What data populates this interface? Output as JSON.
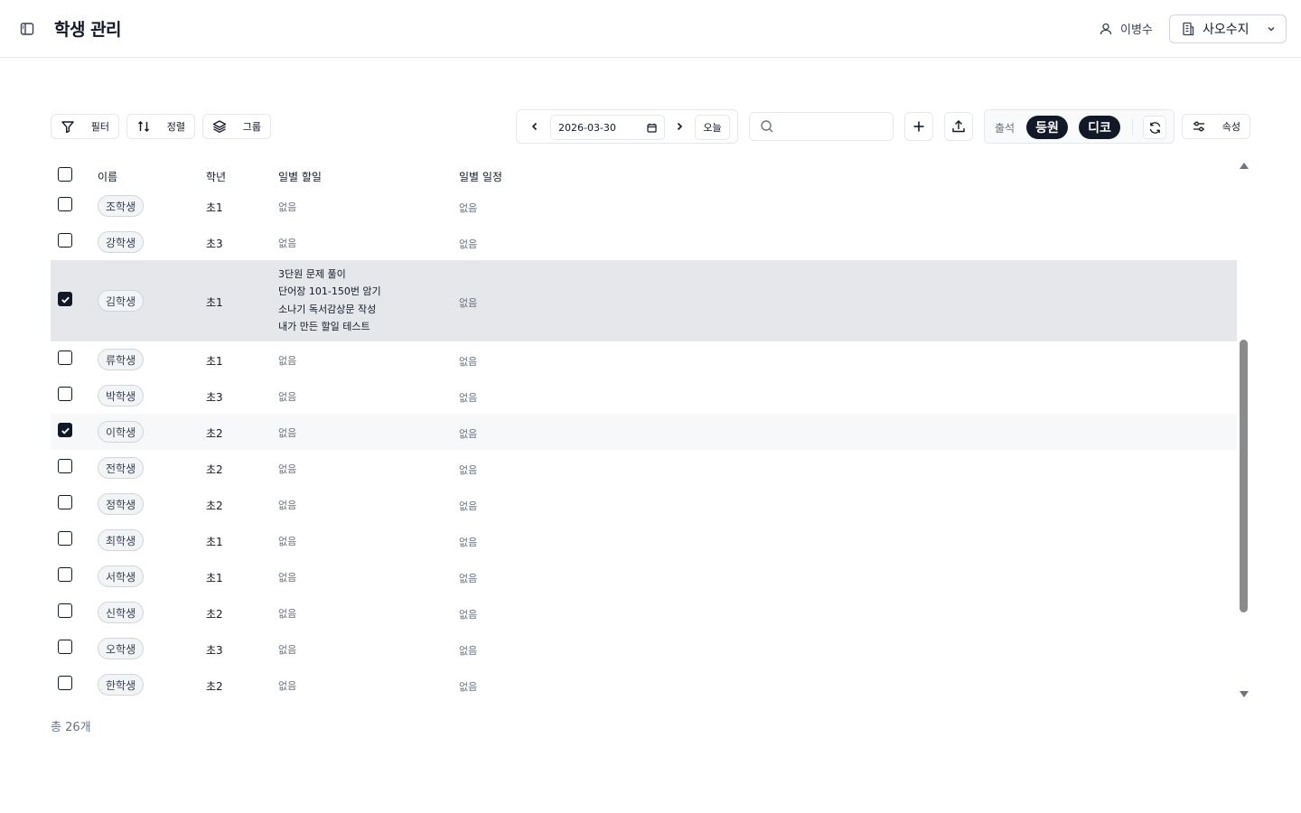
{
  "header": {
    "title": "학생 관리",
    "user_name": "이병수",
    "academy": "사오수지"
  },
  "toolbar": {
    "filter_label": "필터",
    "sort_label": "정렬",
    "group_label": "그룹",
    "date_value": "2026-03-30",
    "today_label": "오늘",
    "search_placeholder": "",
    "attendance_label": "출석",
    "checkin_label": "등원",
    "checkout_label": "디코",
    "properties_label": "속성"
  },
  "table": {
    "columns": [
      "이름",
      "학년",
      "일별 할일",
      "일별 일정"
    ],
    "rows": [
      {
        "name": "조학생",
        "grade": "초1",
        "todos": [
          "없음"
        ],
        "schedule": "없음",
        "checked": false
      },
      {
        "name": "강학생",
        "grade": "초3",
        "todos": [
          "없음"
        ],
        "schedule": "없음",
        "checked": false
      },
      {
        "name": "김학생",
        "grade": "초1",
        "todos": [
          "3단원 문제 풀이",
          "단어장 101-150번 암기",
          "소나기 독서감상문 작성",
          "내가 만든 할일 테스트"
        ],
        "schedule": "없음",
        "checked": true
      },
      {
        "name": "류학생",
        "grade": "초1",
        "todos": [
          "없음"
        ],
        "schedule": "없음",
        "checked": false
      },
      {
        "name": "박학생",
        "grade": "초3",
        "todos": [
          "없음"
        ],
        "schedule": "없음",
        "checked": false
      },
      {
        "name": "이학생",
        "grade": "초2",
        "todos": [
          "없음"
        ],
        "schedule": "없음",
        "checked": true
      },
      {
        "name": "전학생",
        "grade": "초2",
        "todos": [
          "없음"
        ],
        "schedule": "없음",
        "checked": false
      },
      {
        "name": "정학생",
        "grade": "초2",
        "todos": [
          "없음"
        ],
        "schedule": "없음",
        "checked": false
      },
      {
        "name": "최학생",
        "grade": "초1",
        "todos": [
          "없음"
        ],
        "schedule": "없음",
        "checked": false
      },
      {
        "name": "서학생",
        "grade": "초1",
        "todos": [
          "없음"
        ],
        "schedule": "없음",
        "checked": false
      },
      {
        "name": "신학생",
        "grade": "초2",
        "todos": [
          "없음"
        ],
        "schedule": "없음",
        "checked": false
      },
      {
        "name": "오학생",
        "grade": "초3",
        "todos": [
          "없음"
        ],
        "schedule": "없음",
        "checked": false
      },
      {
        "name": "한학생",
        "grade": "초2",
        "todos": [
          "없음"
        ],
        "schedule": "없음",
        "checked": false
      }
    ],
    "total_text": "총 26개"
  }
}
